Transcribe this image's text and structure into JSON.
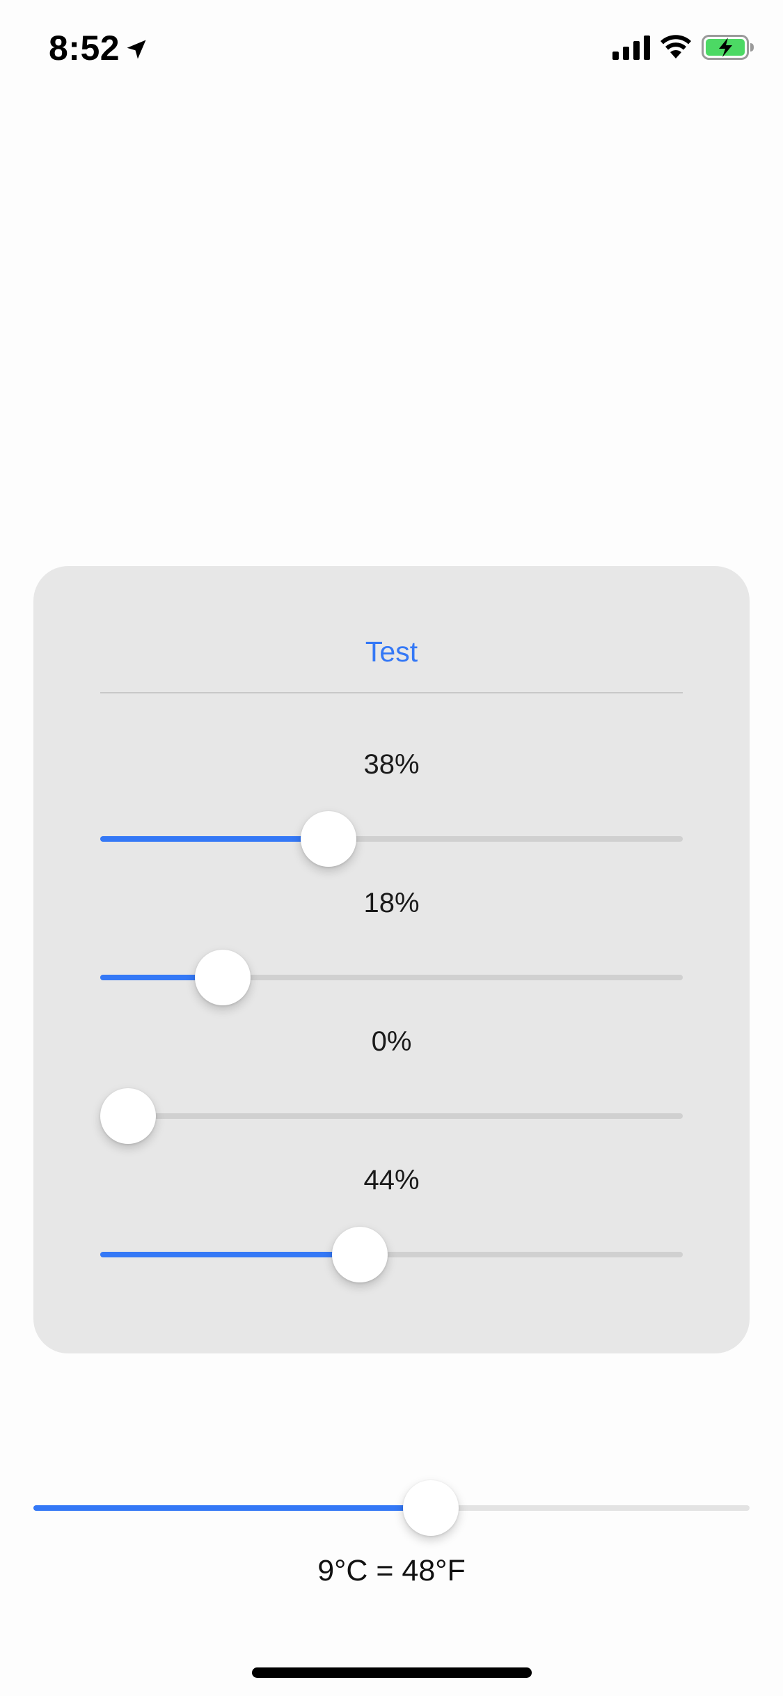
{
  "status_bar": {
    "time": "8:52",
    "icons": [
      "location-arrow-icon",
      "cellular-signal-icon",
      "wifi-icon",
      "battery-charging-icon"
    ],
    "battery_color": "#4cd964"
  },
  "card": {
    "title": "Test",
    "sliders": [
      {
        "label": "38%",
        "value": 0.38
      },
      {
        "label": "18%",
        "value": 0.18
      },
      {
        "label": "0%",
        "value": 0.0
      },
      {
        "label": "44%",
        "value": 0.44
      }
    ]
  },
  "temperature": {
    "slider_value": 0.56,
    "label": "9°C = 48°F"
  },
  "colors": {
    "accent": "#3478f6",
    "card_background": "#e7e7e7",
    "track": "#d0d0d0"
  }
}
